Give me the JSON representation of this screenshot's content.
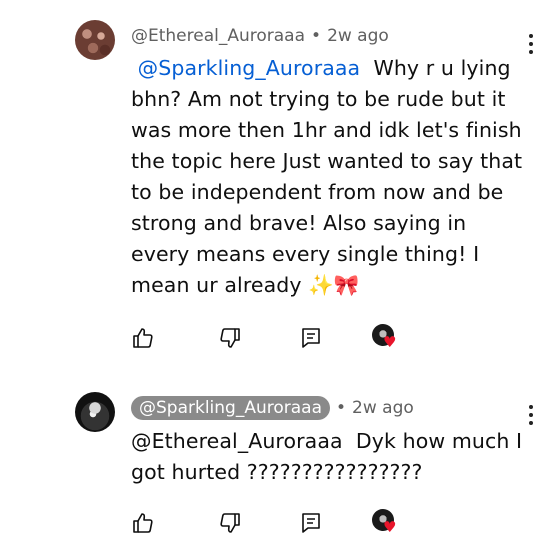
{
  "comments": [
    {
      "author": "@Ethereal_Auroraaa",
      "time": "2w ago",
      "mention": "@Sparkling_Auroraaa",
      "text": "Why r u lying bhn? Am not trying to be rude but it was more then 1hr and idk let's finish the topic here Just wanted to say that to be independent from now and be strong and brave! Also saying in every means every single thing! I mean ur already ✨🎀",
      "actions": {
        "like": "like-icon",
        "dislike": "dislike-icon",
        "reply": "reply-icon",
        "creator_heart": "♥"
      }
    },
    {
      "author": "@Sparkling_Auroraaa",
      "time": "2w ago",
      "mention": "@Ethereal_Auroraaa",
      "text": "Dyk how much I got hurted ????????????????",
      "actions": {
        "like": "like-icon",
        "dislike": "dislike-icon",
        "reply": "reply-icon",
        "creator_heart": "♥"
      }
    }
  ],
  "separator": "•"
}
